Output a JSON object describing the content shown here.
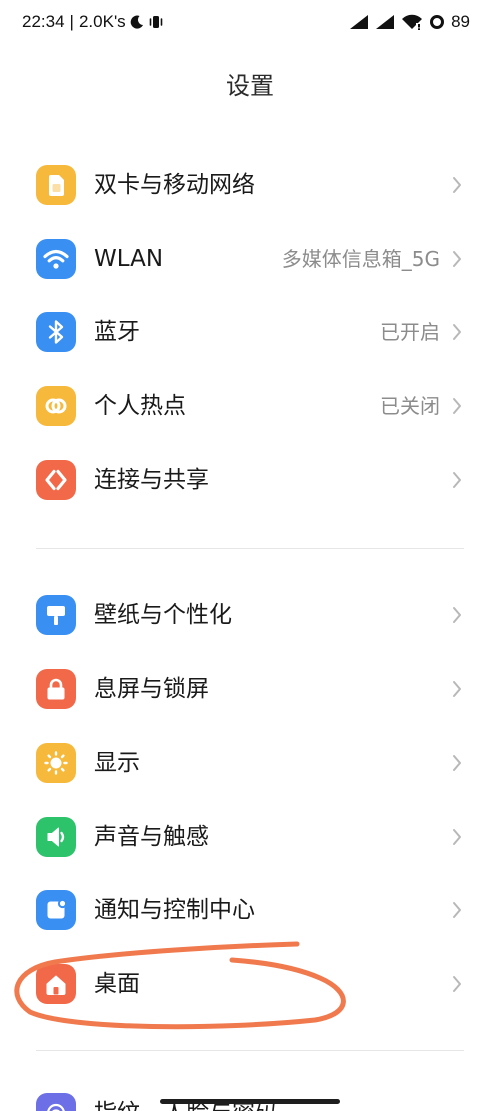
{
  "status_bar": {
    "time": "22:34",
    "separator": "|",
    "network_speed": "2.0K's",
    "left_icons": [
      "moon-icon",
      "vibrate-icon"
    ],
    "right_icons": [
      "signal-icon",
      "signal-icon",
      "wifi-icon",
      "battery-icon"
    ],
    "battery_level": "89"
  },
  "header": {
    "title": "设置"
  },
  "groups": [
    {
      "items": [
        {
          "label": "双卡与移动网络",
          "icon": "sim-card-icon",
          "color": "#F6B93B"
        },
        {
          "label": "WLAN",
          "value": "多媒体信息箱_5G",
          "icon": "wifi-icon",
          "color": "#3A8FF2"
        },
        {
          "label": "蓝牙",
          "value": "已开启",
          "icon": "bluetooth-icon",
          "color": "#3A8FF2"
        },
        {
          "label": "个人热点",
          "value": "已关闭",
          "icon": "hotspot-icon",
          "color": "#F6B93B"
        },
        {
          "label": "连接与共享",
          "icon": "connection-sharing-icon",
          "color": "#F2694A"
        }
      ]
    },
    {
      "items": [
        {
          "label": "壁纸与个性化",
          "icon": "wallpaper-icon",
          "color": "#3A8FF2"
        },
        {
          "label": "息屏与锁屏",
          "icon": "lock-icon",
          "color": "#F2694A"
        },
        {
          "label": "显示",
          "icon": "sun-icon",
          "color": "#F6B93B"
        },
        {
          "label": "声音与触感",
          "icon": "speaker-icon",
          "color": "#2DC36A"
        },
        {
          "label": "通知与控制中心",
          "icon": "notification-icon",
          "color": "#3A8FF2"
        },
        {
          "label": "桌面",
          "icon": "home-icon",
          "color": "#F2694A"
        }
      ]
    },
    {
      "items": [
        {
          "label": "指纹、人脸与密码",
          "icon": "fingerprint-icon",
          "color": "#6C6FE6"
        }
      ]
    }
  ],
  "annotation": {
    "color": "#F07A4E"
  }
}
